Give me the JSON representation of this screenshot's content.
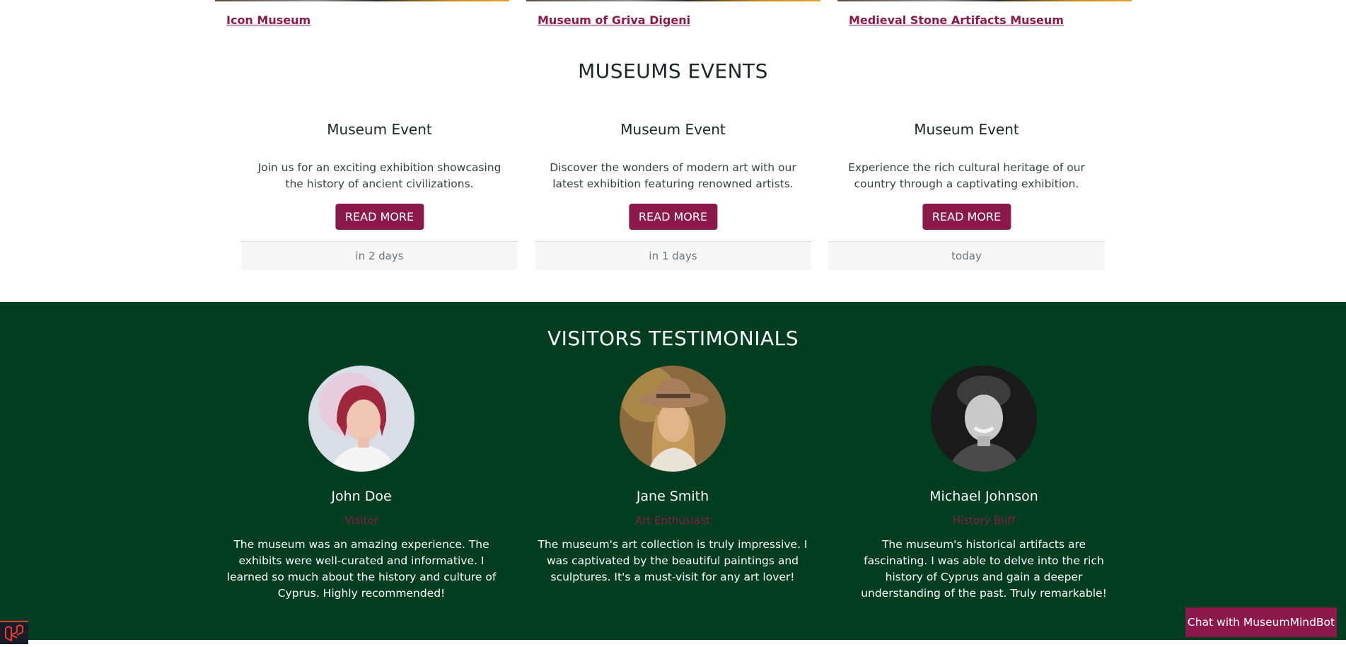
{
  "museums": {
    "links": [
      "Icon Museum",
      "Museum of Griva Digeni",
      "Medieval Stone Artifacts Museum"
    ]
  },
  "events": {
    "title": "MUSEUMS EVENTS",
    "items": [
      {
        "title": "Museum Event",
        "description": "Join us for an exciting exhibition showcasing the history of ancient civilizations.",
        "button": "READ MORE",
        "when": "in 2 days"
      },
      {
        "title": "Museum Event",
        "description": "Discover the wonders of modern art with our latest exhibition featuring renowned artists.",
        "button": "READ MORE",
        "when": "in 1 days"
      },
      {
        "title": "Museum Event",
        "description": "Experience the rich cultural heritage of our country through a captivating exhibition.",
        "button": "READ MORE",
        "when": "today"
      }
    ]
  },
  "testimonials": {
    "title": "VISITORS TESTIMONIALS",
    "items": [
      {
        "name": "John Doe",
        "role": "Visitor",
        "quote": "The museum was an amazing experience. The exhibits were well-curated and informative. I learned so much about the history and culture of Cyprus. Highly recommended!"
      },
      {
        "name": "Jane Smith",
        "role": "Art Enthusiast",
        "quote": "The museum's art collection is truly impressive. I was captivated by the beautiful paintings and sculptures. It's a must-visit for any art lover!"
      },
      {
        "name": "Michael Johnson",
        "role": "History Buff",
        "quote": "The museum's historical artifacts are fascinating. I was able to delve into the rich history of Cyprus and gain a deeper understanding of the past. Truly remarkable!"
      }
    ]
  },
  "chat": {
    "label": "Chat with MuseumMindBot"
  },
  "colors": {
    "accent": "#8b1a4a",
    "testimonials_bg": "#013e21",
    "card_footer_bg": "#f7f7f7"
  },
  "icons": {
    "debug_badge": "laravel-logo-icon"
  }
}
